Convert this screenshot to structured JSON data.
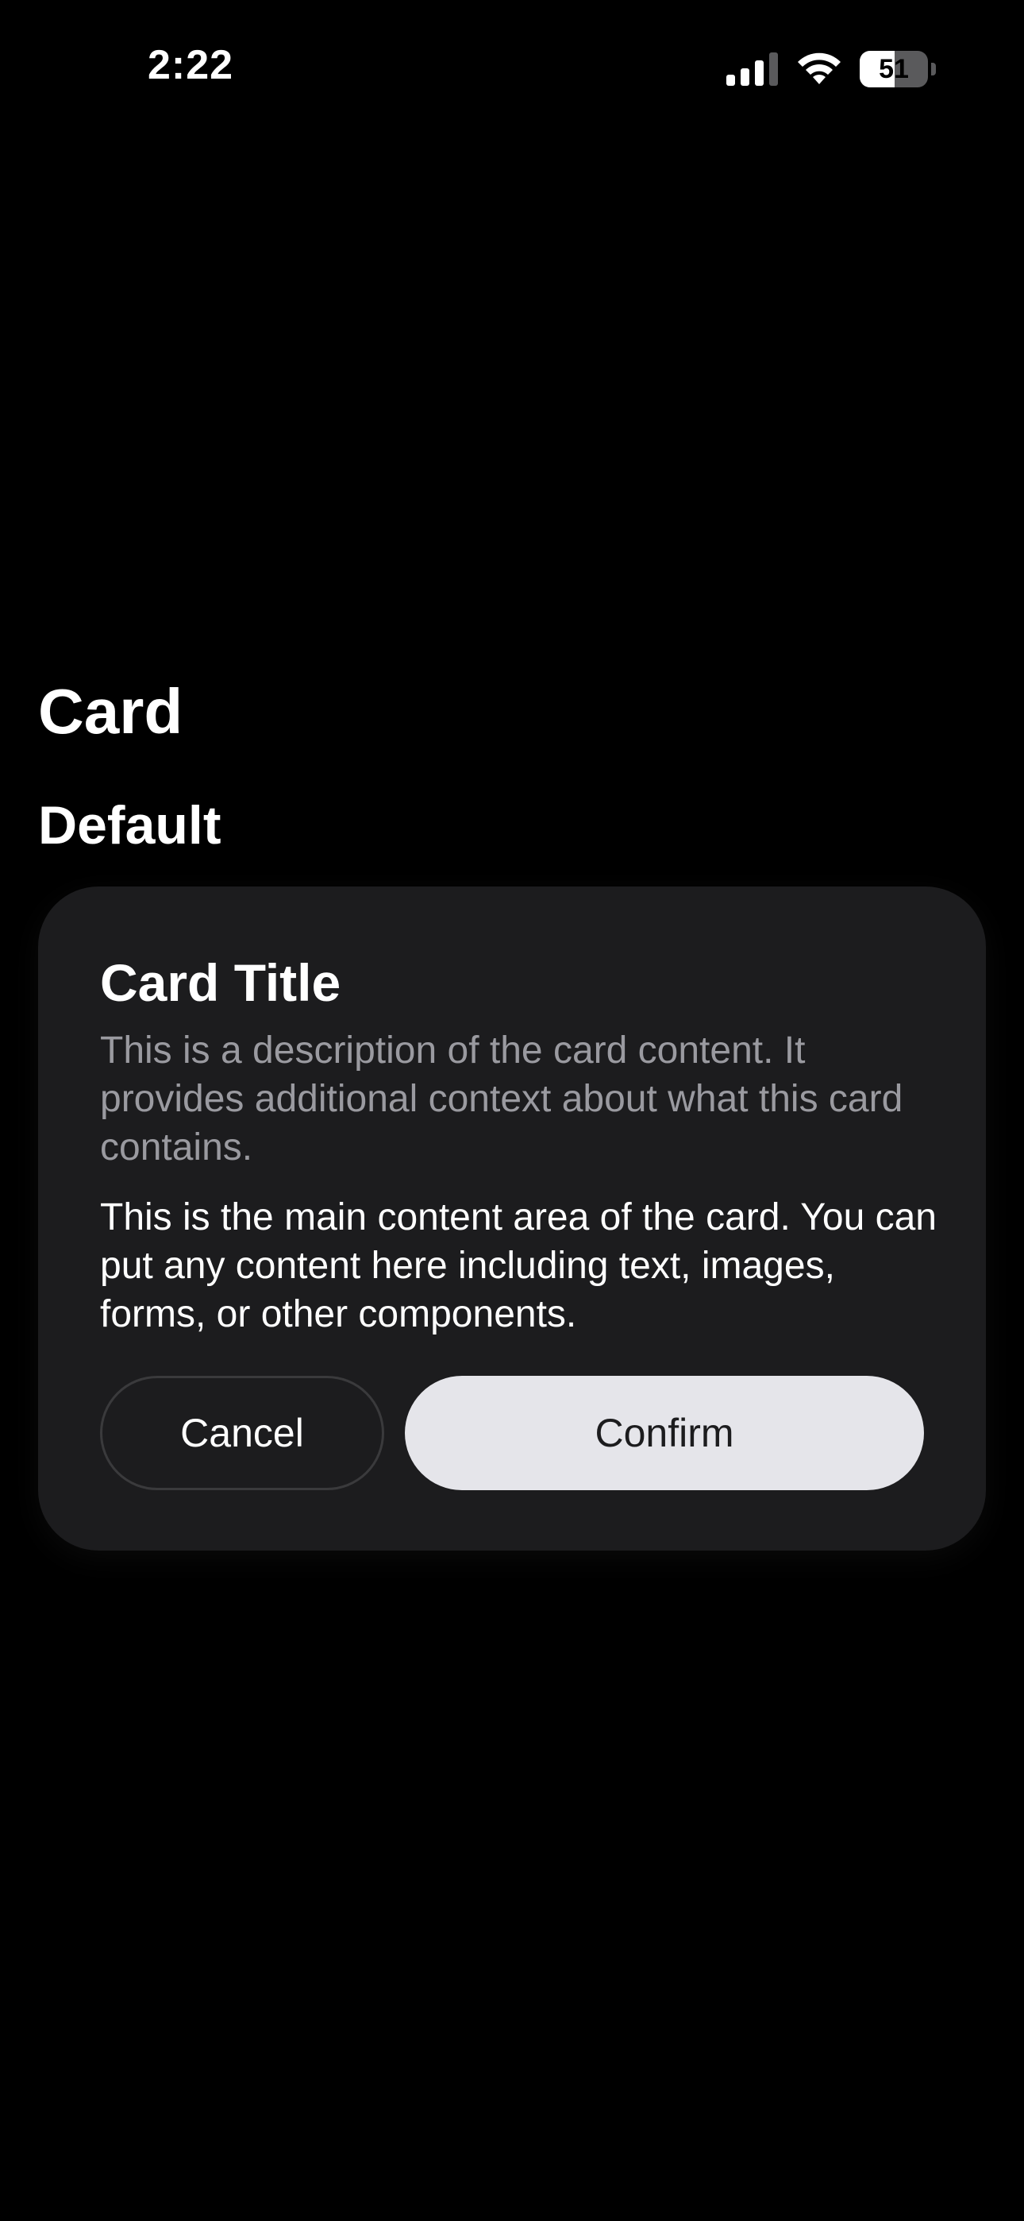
{
  "status_bar": {
    "time": "2:22",
    "battery_percent": 51,
    "battery_label": "51",
    "signal_icon": "cellular-signal-icon",
    "wifi_icon": "wifi-icon",
    "battery_icon": "battery-icon"
  },
  "page": {
    "title": "Card",
    "section_title": "Default"
  },
  "card": {
    "title": "Card Title",
    "description": "This is a description of the card content. It provides additional context about what this card contains.",
    "content": "This is the main content area of the card. You can put any content here including text, images, forms, or other components.",
    "cancel_label": "Cancel",
    "confirm_label": "Confirm"
  },
  "colors": {
    "background": "#000000",
    "card_background": "#1c1c1e",
    "description_text": "#9a9aa0",
    "confirm_button": "#e5e5ea",
    "cancel_border": "#3a3a3c"
  }
}
